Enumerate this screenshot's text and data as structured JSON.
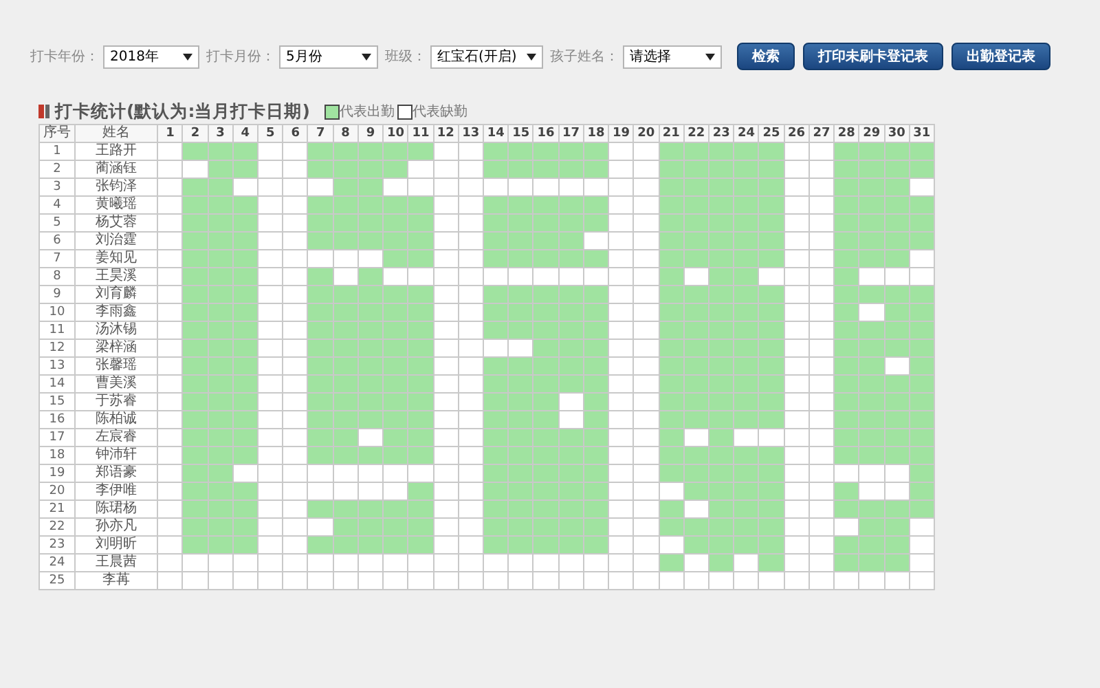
{
  "filters": [
    {
      "label": "打卡年份：",
      "value": "2018年"
    },
    {
      "label": "打卡月份：",
      "value": "5月份"
    },
    {
      "label": "班级：",
      "value": "红宝石(开启)"
    },
    {
      "label": "孩子姓名：",
      "value": "请选择"
    }
  ],
  "buttons": [
    "检索",
    "打印未刷卡登记表",
    "出勤登记表"
  ],
  "section_title": "打卡统计(默认为:当月打卡日期)",
  "legend": [
    {
      "label": "代表出勤",
      "present": true
    },
    {
      "label": "代表缺勤",
      "present": false
    }
  ],
  "table": {
    "columns": [
      "序号",
      "姓名",
      "1",
      "2",
      "3",
      "4",
      "5",
      "6",
      "7",
      "8",
      "9",
      "10",
      "11",
      "12",
      "13",
      "14",
      "15",
      "16",
      "17",
      "18",
      "19",
      "20",
      "21",
      "22",
      "23",
      "24",
      "25",
      "26",
      "27",
      "28",
      "29",
      "30",
      "31"
    ],
    "rows": [
      {
        "no": "1",
        "name": "王路开",
        "present": [
          false,
          true,
          true,
          true,
          false,
          false,
          true,
          true,
          true,
          true,
          true,
          false,
          false,
          true,
          true,
          true,
          true,
          true,
          false,
          false,
          true,
          true,
          true,
          true,
          true,
          false,
          false,
          true,
          true,
          true,
          true
        ]
      },
      {
        "no": "2",
        "name": "蔺涵钰",
        "present": [
          false,
          false,
          true,
          true,
          false,
          false,
          true,
          true,
          true,
          true,
          false,
          false,
          false,
          true,
          true,
          true,
          true,
          true,
          false,
          false,
          true,
          true,
          true,
          true,
          true,
          false,
          false,
          true,
          true,
          true,
          true
        ]
      },
      {
        "no": "3",
        "name": "张钧泽",
        "present": [
          false,
          true,
          true,
          false,
          false,
          false,
          false,
          true,
          true,
          false,
          false,
          false,
          false,
          false,
          false,
          false,
          false,
          false,
          false,
          false,
          true,
          true,
          true,
          true,
          true,
          false,
          false,
          true,
          true,
          true,
          false
        ]
      },
      {
        "no": "4",
        "name": "黄曦瑶",
        "present": [
          false,
          true,
          true,
          true,
          false,
          false,
          true,
          true,
          true,
          true,
          true,
          false,
          false,
          true,
          true,
          true,
          true,
          true,
          false,
          false,
          true,
          true,
          true,
          true,
          true,
          false,
          false,
          true,
          true,
          true,
          true
        ]
      },
      {
        "no": "5",
        "name": "杨艾蓉",
        "present": [
          false,
          true,
          true,
          true,
          false,
          false,
          true,
          true,
          true,
          true,
          true,
          false,
          false,
          true,
          true,
          true,
          true,
          true,
          false,
          false,
          true,
          true,
          true,
          true,
          true,
          false,
          false,
          true,
          true,
          true,
          true
        ]
      },
      {
        "no": "6",
        "name": "刘治霆",
        "present": [
          false,
          true,
          true,
          true,
          false,
          false,
          true,
          true,
          true,
          true,
          true,
          false,
          false,
          true,
          true,
          true,
          true,
          false,
          false,
          false,
          true,
          true,
          true,
          true,
          true,
          false,
          false,
          true,
          true,
          true,
          true
        ]
      },
      {
        "no": "7",
        "name": "姜知见",
        "present": [
          false,
          true,
          true,
          true,
          false,
          false,
          false,
          false,
          false,
          true,
          true,
          false,
          false,
          true,
          true,
          true,
          true,
          true,
          false,
          false,
          true,
          true,
          true,
          true,
          true,
          false,
          false,
          true,
          true,
          true,
          false
        ]
      },
      {
        "no": "8",
        "name": "王昊溪",
        "present": [
          false,
          true,
          true,
          true,
          false,
          false,
          true,
          false,
          true,
          false,
          false,
          false,
          false,
          false,
          false,
          false,
          false,
          false,
          false,
          false,
          true,
          false,
          true,
          true,
          false,
          false,
          false,
          true,
          false,
          false,
          false
        ]
      },
      {
        "no": "9",
        "name": "刘育麟",
        "present": [
          false,
          true,
          true,
          true,
          false,
          false,
          true,
          true,
          true,
          true,
          true,
          false,
          false,
          true,
          true,
          true,
          true,
          true,
          false,
          false,
          true,
          true,
          true,
          true,
          true,
          false,
          false,
          true,
          true,
          true,
          true
        ]
      },
      {
        "no": "10",
        "name": "李雨鑫",
        "present": [
          false,
          true,
          true,
          true,
          false,
          false,
          true,
          true,
          true,
          true,
          true,
          false,
          false,
          true,
          true,
          true,
          true,
          true,
          false,
          false,
          true,
          true,
          true,
          true,
          true,
          false,
          false,
          true,
          false,
          true,
          true
        ]
      },
      {
        "no": "11",
        "name": "汤沐锡",
        "present": [
          false,
          true,
          true,
          true,
          false,
          false,
          true,
          true,
          true,
          true,
          true,
          false,
          false,
          true,
          true,
          true,
          true,
          true,
          false,
          false,
          true,
          true,
          true,
          true,
          true,
          false,
          false,
          true,
          true,
          true,
          true
        ]
      },
      {
        "no": "12",
        "name": "梁梓涵",
        "present": [
          false,
          true,
          true,
          true,
          false,
          false,
          true,
          true,
          true,
          true,
          true,
          false,
          false,
          false,
          false,
          true,
          true,
          true,
          false,
          false,
          true,
          true,
          true,
          true,
          true,
          false,
          false,
          true,
          true,
          true,
          true
        ]
      },
      {
        "no": "13",
        "name": "张馨瑶",
        "present": [
          false,
          true,
          true,
          true,
          false,
          false,
          true,
          true,
          true,
          true,
          true,
          false,
          false,
          true,
          true,
          true,
          true,
          true,
          false,
          false,
          true,
          true,
          true,
          true,
          true,
          false,
          false,
          true,
          true,
          false,
          true
        ]
      },
      {
        "no": "14",
        "name": "曹美溪",
        "present": [
          false,
          true,
          true,
          true,
          false,
          false,
          true,
          true,
          true,
          true,
          true,
          false,
          false,
          true,
          true,
          true,
          true,
          true,
          false,
          false,
          true,
          true,
          true,
          true,
          true,
          false,
          false,
          true,
          true,
          true,
          true
        ]
      },
      {
        "no": "15",
        "name": "于苏睿",
        "present": [
          false,
          true,
          true,
          true,
          false,
          false,
          true,
          true,
          true,
          true,
          true,
          false,
          false,
          true,
          true,
          true,
          false,
          true,
          false,
          false,
          true,
          true,
          true,
          true,
          true,
          false,
          false,
          true,
          true,
          true,
          true
        ]
      },
      {
        "no": "16",
        "name": "陈柏诚",
        "present": [
          false,
          true,
          true,
          true,
          false,
          false,
          true,
          true,
          true,
          true,
          true,
          false,
          false,
          true,
          true,
          true,
          false,
          true,
          false,
          false,
          true,
          true,
          true,
          true,
          true,
          false,
          false,
          true,
          true,
          true,
          true
        ]
      },
      {
        "no": "17",
        "name": "左宸睿",
        "present": [
          false,
          true,
          true,
          true,
          false,
          false,
          true,
          true,
          false,
          true,
          true,
          false,
          false,
          true,
          true,
          true,
          true,
          true,
          false,
          false,
          true,
          false,
          true,
          false,
          false,
          false,
          false,
          true,
          true,
          true,
          true
        ]
      },
      {
        "no": "18",
        "name": "钟沛轩",
        "present": [
          false,
          true,
          true,
          true,
          false,
          false,
          true,
          true,
          true,
          true,
          true,
          false,
          false,
          true,
          true,
          true,
          true,
          true,
          false,
          false,
          true,
          true,
          true,
          true,
          true,
          false,
          false,
          true,
          true,
          true,
          true
        ]
      },
      {
        "no": "19",
        "name": "郑语豪",
        "present": [
          false,
          true,
          true,
          false,
          false,
          false,
          false,
          false,
          false,
          false,
          false,
          false,
          false,
          true,
          true,
          true,
          true,
          true,
          false,
          false,
          true,
          true,
          true,
          true,
          true,
          false,
          false,
          false,
          false,
          false,
          true
        ]
      },
      {
        "no": "20",
        "name": "李伊唯",
        "present": [
          false,
          true,
          true,
          true,
          false,
          false,
          false,
          false,
          false,
          false,
          true,
          false,
          false,
          true,
          true,
          true,
          true,
          true,
          false,
          false,
          false,
          true,
          true,
          true,
          true,
          false,
          false,
          true,
          false,
          false,
          true
        ]
      },
      {
        "no": "21",
        "name": "陈珺杨",
        "present": [
          false,
          true,
          true,
          true,
          false,
          false,
          true,
          true,
          true,
          true,
          true,
          false,
          false,
          true,
          true,
          true,
          true,
          true,
          false,
          false,
          true,
          false,
          true,
          true,
          true,
          false,
          false,
          true,
          true,
          true,
          true
        ]
      },
      {
        "no": "22",
        "name": "孙亦凡",
        "present": [
          false,
          true,
          true,
          true,
          false,
          false,
          false,
          true,
          true,
          true,
          true,
          false,
          false,
          true,
          true,
          true,
          true,
          true,
          false,
          false,
          true,
          true,
          true,
          true,
          true,
          false,
          false,
          false,
          true,
          true,
          false
        ]
      },
      {
        "no": "23",
        "name": "刘明昕",
        "present": [
          false,
          true,
          true,
          true,
          false,
          false,
          true,
          true,
          true,
          true,
          true,
          false,
          false,
          true,
          true,
          true,
          true,
          true,
          false,
          false,
          false,
          true,
          true,
          true,
          true,
          false,
          false,
          true,
          true,
          true,
          false
        ]
      },
      {
        "no": "24",
        "name": "王晨茜",
        "present": [
          false,
          false,
          false,
          false,
          false,
          false,
          false,
          false,
          false,
          false,
          false,
          false,
          false,
          false,
          false,
          false,
          false,
          false,
          false,
          false,
          true,
          false,
          true,
          false,
          true,
          false,
          false,
          true,
          true,
          true,
          false
        ]
      },
      {
        "no": "25",
        "name": "李苒",
        "present": [
          false,
          false,
          false,
          false,
          false,
          false,
          false,
          false,
          false,
          false,
          false,
          false,
          false,
          false,
          false,
          false,
          false,
          false,
          false,
          false,
          false,
          false,
          false,
          false,
          false,
          false,
          false,
          false,
          false,
          false,
          false
        ]
      }
    ]
  }
}
